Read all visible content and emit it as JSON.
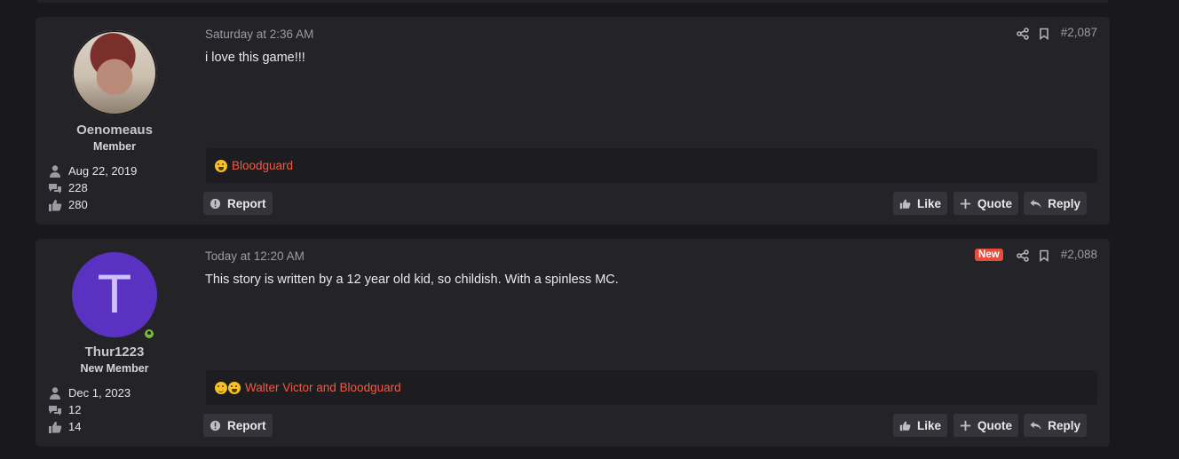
{
  "posts": [
    {
      "username": "Oenomeaus",
      "user_title": "Member",
      "joined": "Aug 22, 2019",
      "messages": "228",
      "reaction_score": "280",
      "time": "Saturday at 2:36 AM",
      "post_number": "#2,087",
      "is_new": false,
      "message": "i love this game!!!",
      "reactions_text": "Bloodguard",
      "avatar": {
        "type": "photo"
      }
    },
    {
      "username": "Thur1223",
      "user_title": "New Member",
      "joined": "Dec 1, 2023",
      "messages": "12",
      "reaction_score": "14",
      "time": "Today at 12:20 AM",
      "post_number": "#2,088",
      "is_new": true,
      "new_badge": "New",
      "message": "This story is written by a 12 year old kid, so childish. With a spinless MC.",
      "reactions_text": "Walter Victor and Bloodguard",
      "avatar": {
        "type": "letter",
        "letter": "T",
        "color": "#5a32c2"
      },
      "online": true
    }
  ],
  "actions": {
    "report_label": "Report",
    "like_label": "Like",
    "quote_label": "Quote",
    "reply_label": "Reply"
  },
  "colors": {
    "background": "#19191d",
    "panel": "#232328",
    "accent_red": "#ef5b44",
    "new_badge": "#e74c3c"
  }
}
